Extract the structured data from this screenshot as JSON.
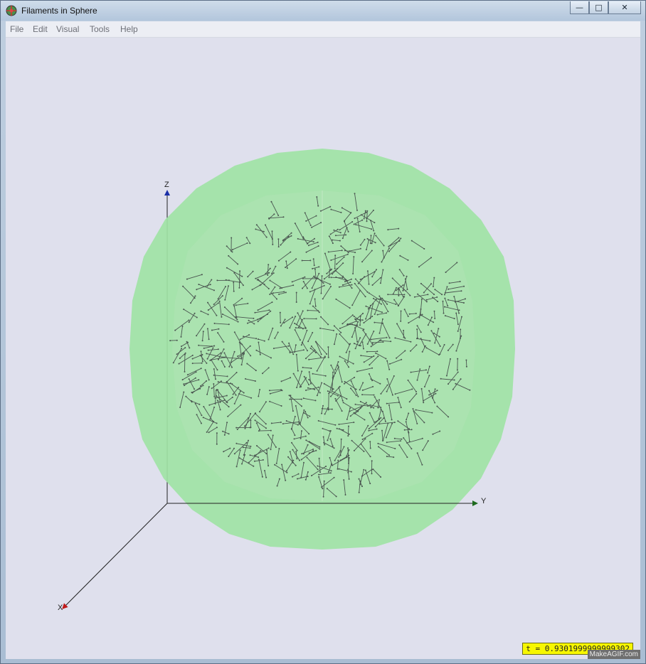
{
  "window": {
    "title": "Filaments in Sphere",
    "controls": {
      "minimize": "—",
      "maximize": "□",
      "close": "✕"
    }
  },
  "menu": [
    "File",
    "Edit",
    "Visual",
    "Tools",
    "Help"
  ],
  "axes": {
    "x": "X",
    "y": "Y",
    "z": "Z"
  },
  "status": {
    "time": "t = 0.9301999999999302"
  },
  "watermark": "MakeAGIF.com",
  "colors": {
    "background": "#dfe0ed",
    "sphere_fill": "#9fe3a5",
    "sphere_inner": "#a9e0ae",
    "filament": "#4a5550",
    "status_bg": "#f7f700",
    "z_arrow": "#1a2ea8",
    "y_arrow": "#1e6b1e",
    "x_arrow": "#c01a1a"
  },
  "icons": {
    "app": "app-sphere-icon"
  }
}
